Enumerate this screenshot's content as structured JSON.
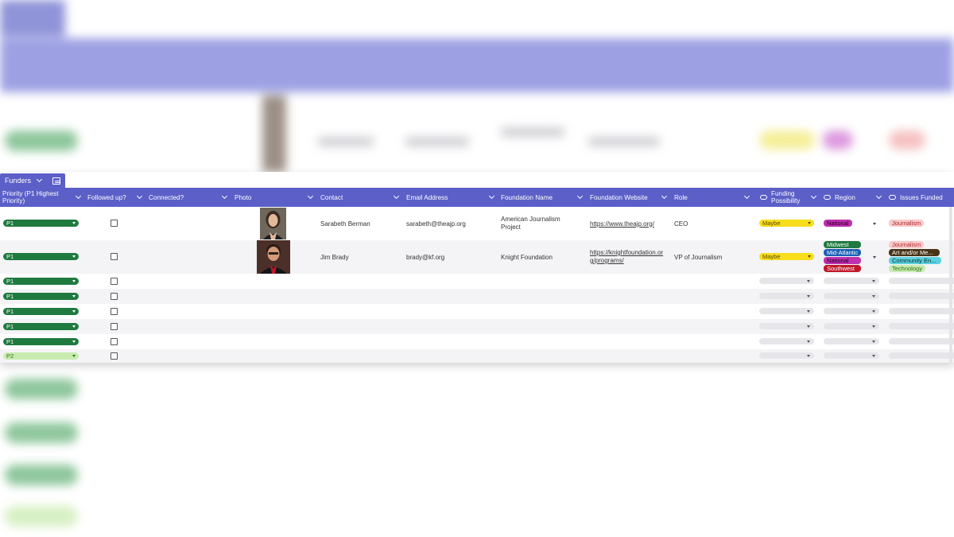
{
  "tab": {
    "label": "Funders"
  },
  "columns": [
    {
      "key": "priority",
      "label": "Priority (P1 Highest Priority)"
    },
    {
      "key": "followed",
      "label": "Followed up?"
    },
    {
      "key": "connected",
      "label": "Connected?"
    },
    {
      "key": "photo",
      "label": "Photo"
    },
    {
      "key": "contact",
      "label": "Contact"
    },
    {
      "key": "email",
      "label": "Email Address"
    },
    {
      "key": "foundation",
      "label": "Foundation Name"
    },
    {
      "key": "website",
      "label": "Foundation Website"
    },
    {
      "key": "role",
      "label": "Role"
    },
    {
      "key": "funding",
      "label": "Funding Possibility"
    },
    {
      "key": "region",
      "label": "Region"
    },
    {
      "key": "issues",
      "label": "Issues Funded"
    }
  ],
  "rows": [
    {
      "priority": "P1",
      "contact": "Sarabeth Berman",
      "email": "sarabeth@theajp.org",
      "foundation": "American Journalism Project",
      "website": "https://www.theajp.org/",
      "role": "CEO",
      "funding": "Maybe",
      "region": [
        "National"
      ],
      "issues": [
        "Journalism"
      ]
    },
    {
      "priority": "P1",
      "contact": "Jim Brady",
      "email": "brady@kf.org",
      "foundation": "Knight Foundation",
      "website": "https://knightfoundation.org/programs/",
      "role": "VP of Journalism",
      "funding": "Maybe",
      "region": [
        "Midwest",
        "Mid-Atlantic",
        "National",
        "Southwest"
      ],
      "issues": [
        "Journalism",
        "Art and/or Me...",
        "Community En...",
        "Technology"
      ]
    },
    {
      "priority": "P1"
    },
    {
      "priority": "P1"
    },
    {
      "priority": "P1"
    },
    {
      "priority": "P1"
    },
    {
      "priority": "P1"
    },
    {
      "priority": "P2"
    }
  ],
  "colors": {
    "header": "#5b5fc7",
    "p1": "#1f7a3f",
    "p2": "#c8ecb0",
    "maybe": "#f7dd1c",
    "national": "#c02fb0",
    "midwest": "#1f7a3f",
    "mid_atlantic": "#1b5fb5",
    "southwest": "#c0182a",
    "journalism": "#f8c9c9",
    "art": "#4a3418",
    "community": "#5bd1e0",
    "technology": "#c8ecb0"
  }
}
